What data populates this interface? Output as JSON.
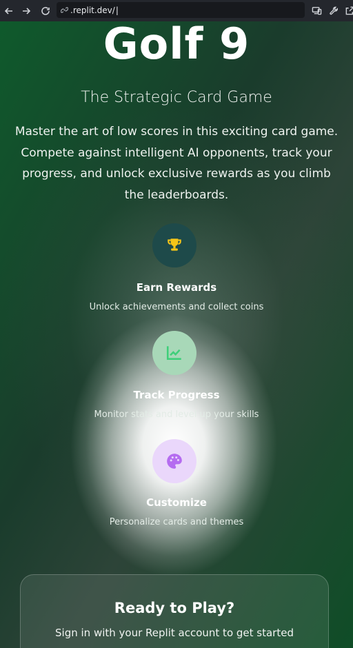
{
  "browser": {
    "url": ".replit.dev/"
  },
  "hero": {
    "title": "Golf 9",
    "subtitle": "The Strategic Card Game",
    "description": "Master the art of low scores in this exciting card game. Compete against intelligent AI opponents, track your progress, and unlock exclusive rewards as you climb the leaderboards."
  },
  "features": [
    {
      "icon": "trophy-icon",
      "title": "Earn Rewards",
      "description": "Unlock achievements and collect coins",
      "icon_bg": "#1e4a4a",
      "icon_color": "#f5c518"
    },
    {
      "icon": "chart-line-icon",
      "title": "Track Progress",
      "description": "Monitor stats and level up your skills",
      "icon_bg": "#a8d8b8",
      "icon_color": "#3fcf7a"
    },
    {
      "icon": "palette-icon",
      "title": "Customize",
      "description": "Personalize cards and themes",
      "icon_bg": "#ead7fb",
      "icon_color": "#b56cf0"
    }
  ],
  "cta": {
    "title": "Ready to Play?",
    "subtitle": "Sign in with your Replit account to get started"
  }
}
